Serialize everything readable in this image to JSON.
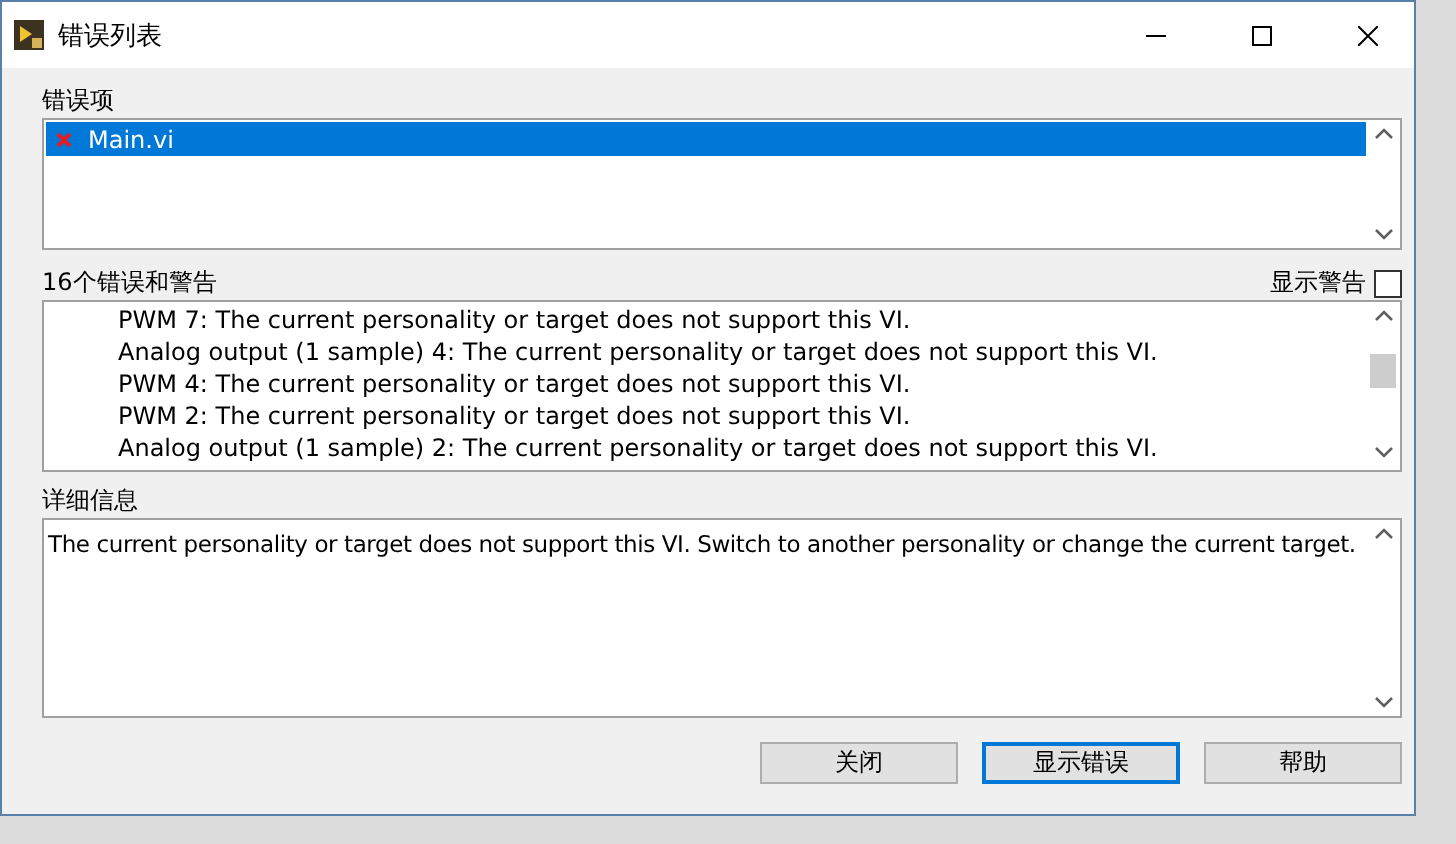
{
  "window": {
    "title": "错误列表"
  },
  "error_items": {
    "label": "错误项",
    "items": [
      {
        "name": "Main.vi",
        "selected": true
      }
    ]
  },
  "errors_and_warnings": {
    "label": "16个错误和警告",
    "show_warnings": {
      "label": "显示警告",
      "checked": false
    },
    "items": [
      {
        "text": "PWM 7: The current personality or target does not support this VI."
      },
      {
        "text": "Analog output (1 sample) 4: The current personality or target does not support this VI."
      },
      {
        "text": "PWM 4: The current personality or target does not support this VI."
      },
      {
        "text": "PWM 2: The current personality or target does not support this VI."
      },
      {
        "text": "Analog output (1 sample) 2: The current personality or target does not support this VI."
      }
    ]
  },
  "details": {
    "label": "详细信息",
    "text": "The current personality or target does not support this VI. Switch to another personality or change the current target."
  },
  "buttons": [
    {
      "label": "关闭",
      "default": false
    },
    {
      "label": "显示错误",
      "default": true
    },
    {
      "label": "帮助",
      "default": false
    }
  ]
}
